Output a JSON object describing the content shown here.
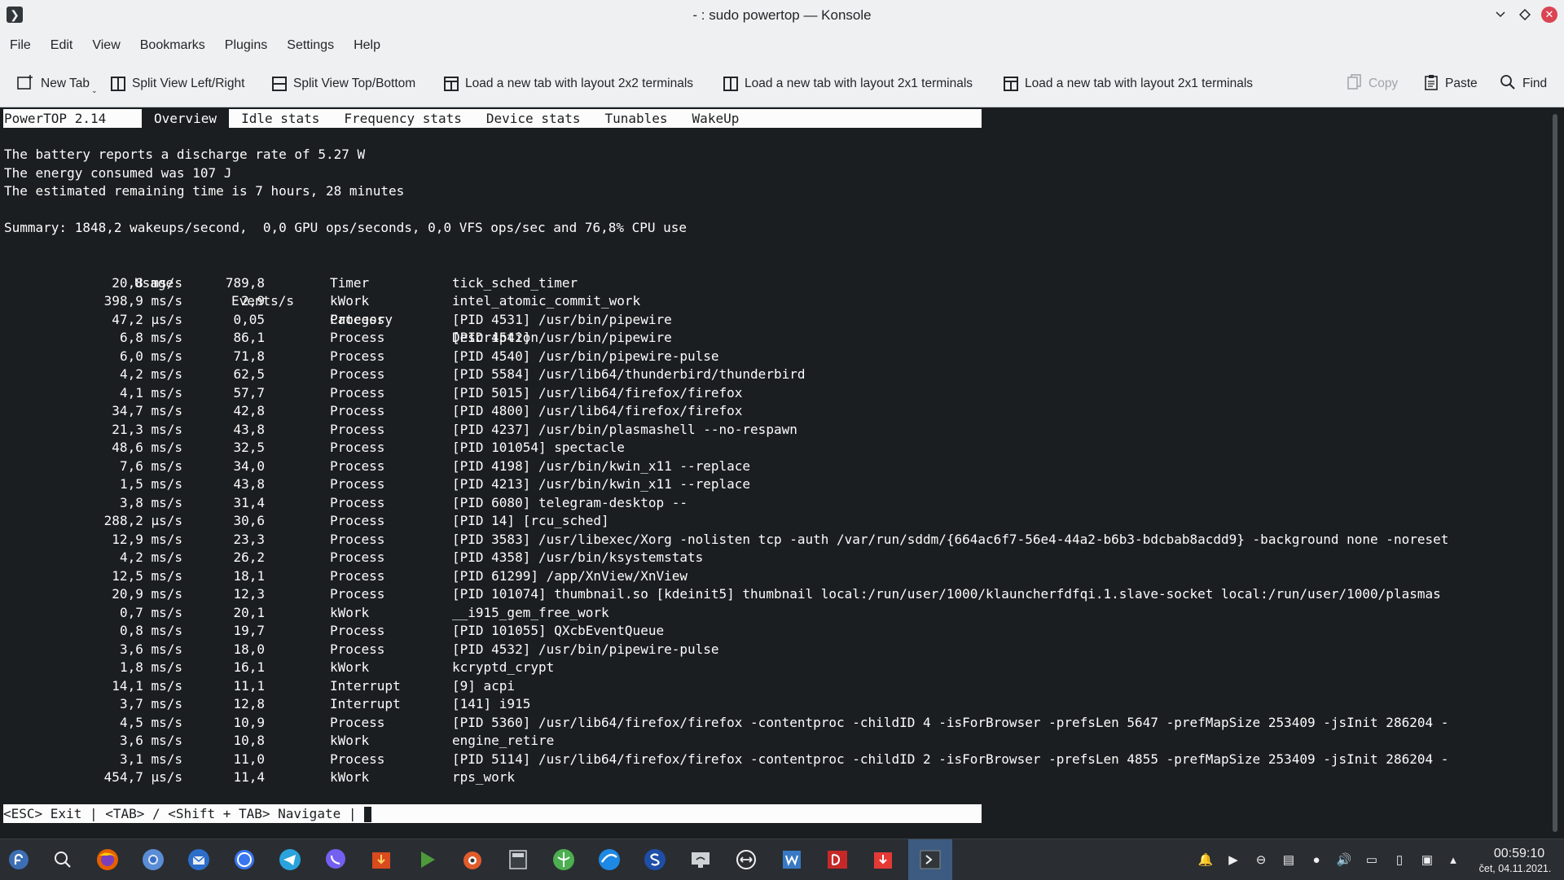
{
  "window": {
    "title": "- : sudo powertop — Konsole"
  },
  "menu": [
    "File",
    "Edit",
    "View",
    "Bookmarks",
    "Plugins",
    "Settings",
    "Help"
  ],
  "toolbar": {
    "new_tab": "New Tab",
    "split_lr": "Split View Left/Right",
    "split_tb": "Split View Top/Bottom",
    "layout_2x2": "Load a new tab with layout 2x2 terminals",
    "layout_2x1_a": "Load a new tab with layout 2x1 terminals",
    "layout_2x1_b": "Load a new tab with layout 2x1 terminals",
    "copy": "Copy",
    "paste": "Paste",
    "find": "Find"
  },
  "powertop": {
    "version": "PowerTOP 2.14",
    "tabs": [
      "Overview",
      "Idle stats",
      "Frequency stats",
      "Device stats",
      "Tunables",
      "WakeUp"
    ],
    "battery_line": "The battery reports a discharge rate of 5.27 W",
    "energy_line": "The energy consumed was 107 J",
    "remaining_line": "The estimated remaining time is 7 hours, 28 minutes",
    "summary_line": "Summary: 1848,2 wakeups/second,  0,0 GPU ops/seconds, 0,0 VFS ops/sec and 76,8% CPU use",
    "headers": {
      "usage": "Usage",
      "events": "Events/s",
      "category": "Category",
      "description": "Description"
    },
    "rows": [
      [
        "20,8 ms/s",
        "789,8",
        "Timer",
        "tick_sched_timer"
      ],
      [
        "398,9 ms/s",
        "2,9",
        "kWork",
        "intel_atomic_commit_work"
      ],
      [
        "47,2 µs/s",
        "0,05",
        "Process",
        "[PID 4531] /usr/bin/pipewire"
      ],
      [
        "6,8 ms/s",
        "86,1",
        "Process",
        "[PID 4542] /usr/bin/pipewire"
      ],
      [
        "6,0 ms/s",
        "71,8",
        "Process",
        "[PID 4540] /usr/bin/pipewire-pulse"
      ],
      [
        "4,2 ms/s",
        "62,5",
        "Process",
        "[PID 5584] /usr/lib64/thunderbird/thunderbird"
      ],
      [
        "4,1 ms/s",
        "57,7",
        "Process",
        "[PID 5015] /usr/lib64/firefox/firefox"
      ],
      [
        "34,7 ms/s",
        "42,8",
        "Process",
        "[PID 4800] /usr/lib64/firefox/firefox"
      ],
      [
        "21,3 ms/s",
        "43,8",
        "Process",
        "[PID 4237] /usr/bin/plasmashell --no-respawn"
      ],
      [
        "48,6 ms/s",
        "32,5",
        "Process",
        "[PID 101054] spectacle"
      ],
      [
        "7,6 ms/s",
        "34,0",
        "Process",
        "[PID 4198] /usr/bin/kwin_x11 --replace"
      ],
      [
        "1,5 ms/s",
        "43,8",
        "Process",
        "[PID 4213] /usr/bin/kwin_x11 --replace"
      ],
      [
        "3,8 ms/s",
        "31,4",
        "Process",
        "[PID 6080] telegram-desktop --"
      ],
      [
        "288,2 µs/s",
        "30,6",
        "Process",
        "[PID 14] [rcu_sched]"
      ],
      [
        "12,9 ms/s",
        "23,3",
        "Process",
        "[PID 3583] /usr/libexec/Xorg -nolisten tcp -auth /var/run/sddm/{664ac6f7-56e4-44a2-b6b3-bdcbab8acdd9} -background none -noreset"
      ],
      [
        "4,2 ms/s",
        "26,2",
        "Process",
        "[PID 4358] /usr/bin/ksystemstats"
      ],
      [
        "12,5 ms/s",
        "18,1",
        "Process",
        "[PID 61299] /app/XnView/XnView"
      ],
      [
        "20,9 ms/s",
        "12,3",
        "Process",
        "[PID 101074] thumbnail.so [kdeinit5] thumbnail local:/run/user/1000/klauncherfdfqi.1.slave-socket local:/run/user/1000/plasmas"
      ],
      [
        "0,7 ms/s",
        "20,1",
        "kWork",
        "__i915_gem_free_work"
      ],
      [
        "0,8 ms/s",
        "19,7",
        "Process",
        "[PID 101055] QXcbEventQueue"
      ],
      [
        "3,6 ms/s",
        "18,0",
        "Process",
        "[PID 4532] /usr/bin/pipewire-pulse"
      ],
      [
        "1,8 ms/s",
        "16,1",
        "kWork",
        "kcryptd_crypt"
      ],
      [
        "14,1 ms/s",
        "11,1",
        "Interrupt",
        "[9] acpi"
      ],
      [
        "3,7 ms/s",
        "12,8",
        "Interrupt",
        "[141] i915"
      ],
      [
        "4,5 ms/s",
        "10,9",
        "Process",
        "[PID 5360] /usr/lib64/firefox/firefox -contentproc -childID 4 -isForBrowser -prefsLen 5647 -prefMapSize 253409 -jsInit 286204 -"
      ],
      [
        "3,6 ms/s",
        "10,8",
        "kWork",
        "engine_retire"
      ],
      [
        "3,1 ms/s",
        "11,0",
        "Process",
        "[PID 5114] /usr/lib64/firefox/firefox -contentproc -childID 2 -isForBrowser -prefsLen 4855 -prefMapSize 253409 -jsInit 286204 -"
      ],
      [
        "454,7 µs/s",
        "11,4",
        "kWork",
        "rps_work"
      ]
    ],
    "status": "<ESC> Exit | <TAB> / <Shift + TAB> Navigate | "
  },
  "taskbar": {
    "apps": [
      "app-launcher",
      "search",
      "firefox",
      "chromium",
      "thunderbird",
      "signal",
      "telegram",
      "viber",
      "downloader",
      "media-player",
      "gimp",
      "calculator",
      "gnome-maps",
      "browser-blue",
      "skype",
      "network-viewer",
      "teamviewer",
      "wps-writer",
      "double-commander",
      "downloader-2",
      "konsole"
    ],
    "clock_time": "00:59:10",
    "clock_date": "čet, 04.11.2021."
  },
  "colors": {
    "terminal_bg": "#1b1e20",
    "terminal_fg": "#fcfcfc",
    "chrome_bg": "#eff0f1",
    "taskbar_bg": "#2a2e32",
    "close": "#da4453"
  }
}
